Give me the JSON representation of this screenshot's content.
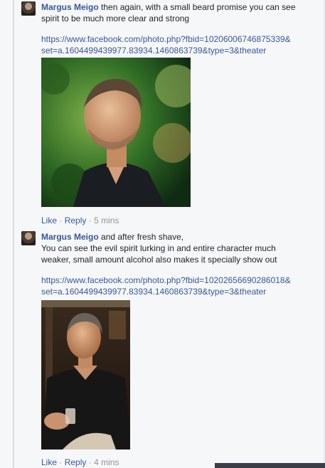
{
  "comments": [
    {
      "author": "Margus Meigo",
      "text_first": "then again, with a small beard promise you can see",
      "text_rest": "spirit to be much more clear and strong",
      "link_line1": "https://www.facebook.com/photo.php?fbid=10206006746875339&",
      "link_line2": "set=a.1604499439977.83934.1460863739&type=3&theater",
      "like": "Like",
      "reply": "Reply",
      "sep": "·",
      "time": "5 mins"
    },
    {
      "author": "Margus Meigo",
      "text_first": "and after fresh shave,",
      "text_line2": "You can see the evil spirit lurking in and entire character much",
      "text_line3": "weaker, small amount alcohol also makes it specially show out",
      "link_line1": "https://www.facebook.com/photo.php?fbid=10202656690286018&",
      "link_line2": "set=a.1604499439977.83934.1460863739&type=3&theater",
      "like": "Like",
      "reply": "Reply",
      "sep": "·",
      "time": "4 mins"
    }
  ]
}
